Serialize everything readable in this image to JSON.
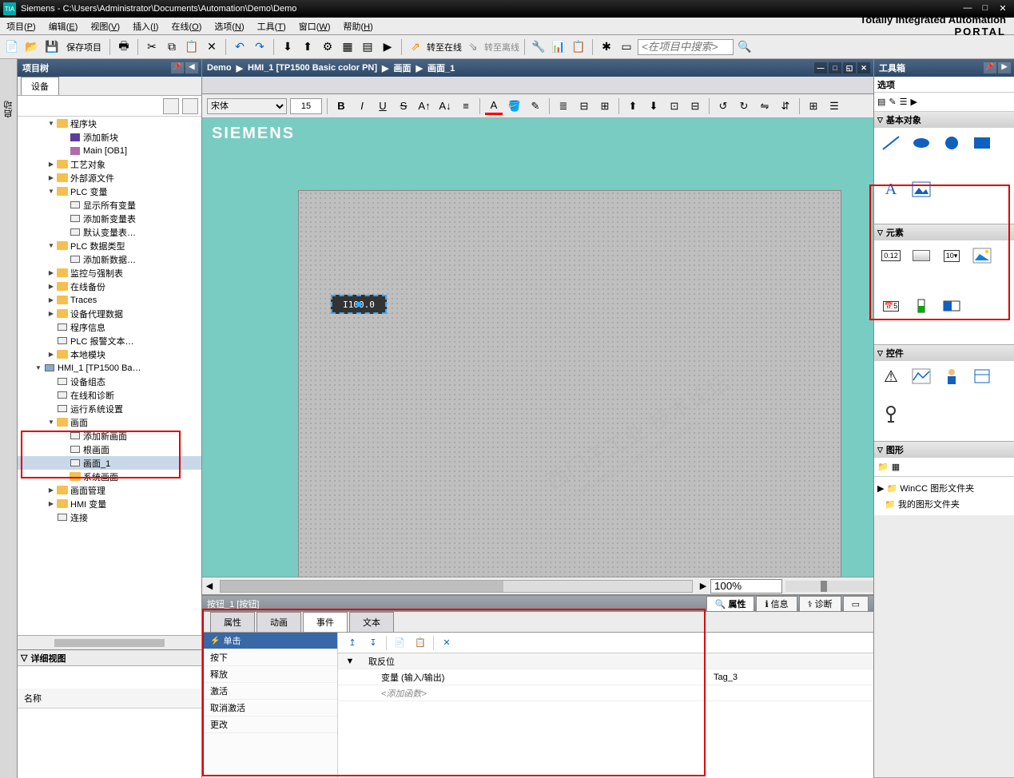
{
  "titlebar": {
    "app": "Siemens",
    "path": "C:\\Users\\Administrator\\Documents\\Automation\\Demo\\Demo"
  },
  "menu": {
    "items": [
      {
        "label": "项目",
        "key": "P"
      },
      {
        "label": "编辑",
        "key": "E"
      },
      {
        "label": "视图",
        "key": "V"
      },
      {
        "label": "插入",
        "key": "I"
      },
      {
        "label": "在线",
        "key": "O"
      },
      {
        "label": "选项",
        "key": "N"
      },
      {
        "label": "工具",
        "key": "T"
      },
      {
        "label": "窗口",
        "key": "W"
      },
      {
        "label": "帮助",
        "key": "H"
      }
    ]
  },
  "brand": {
    "line1": "Totally Integrated Automation",
    "line2": "PORTAL"
  },
  "toolbar": {
    "save_label": "保存项目",
    "go_online": "转至在线",
    "go_offline": "转至离线",
    "search_placeholder": "<在项目中搜索>"
  },
  "project_tree": {
    "title": "项目树",
    "tab": "设备",
    "detail_title": "详细视图",
    "detail_col": "名称",
    "nodes": [
      {
        "indent": 1,
        "exp": "▼",
        "label": "程序块",
        "type": "folder"
      },
      {
        "indent": 2,
        "exp": "",
        "label": "添加新块",
        "type": "block"
      },
      {
        "indent": 2,
        "exp": "",
        "label": "Main [OB1]",
        "type": "db"
      },
      {
        "indent": 1,
        "exp": "▶",
        "label": "工艺对象",
        "type": "folder"
      },
      {
        "indent": 1,
        "exp": "▶",
        "label": "外部源文件",
        "type": "folder"
      },
      {
        "indent": 1,
        "exp": "▼",
        "label": "PLC 变量",
        "type": "folder"
      },
      {
        "indent": 2,
        "exp": "",
        "label": "显示所有变量",
        "type": "screen"
      },
      {
        "indent": 2,
        "exp": "",
        "label": "添加新变量表",
        "type": "screen"
      },
      {
        "indent": 2,
        "exp": "",
        "label": "默认变量表…",
        "type": "screen"
      },
      {
        "indent": 1,
        "exp": "▼",
        "label": "PLC 数据类型",
        "type": "folder"
      },
      {
        "indent": 2,
        "exp": "",
        "label": "添加新数据…",
        "type": "screen"
      },
      {
        "indent": 1,
        "exp": "▶",
        "label": "监控与强制表",
        "type": "folder"
      },
      {
        "indent": 1,
        "exp": "▶",
        "label": "在线备份",
        "type": "folder"
      },
      {
        "indent": 1,
        "exp": "▶",
        "label": "Traces",
        "type": "folder"
      },
      {
        "indent": 1,
        "exp": "▶",
        "label": "设备代理数据",
        "type": "folder"
      },
      {
        "indent": 1,
        "exp": "",
        "label": "程序信息",
        "type": "screen"
      },
      {
        "indent": 1,
        "exp": "",
        "label": "PLC 报警文本…",
        "type": "screen"
      },
      {
        "indent": 1,
        "exp": "▶",
        "label": "本地模块",
        "type": "folder"
      },
      {
        "indent": 0,
        "exp": "▼",
        "label": "HMI_1 [TP1500 Ba…",
        "type": "hmi"
      },
      {
        "indent": 1,
        "exp": "",
        "label": "设备组态",
        "type": "screen"
      },
      {
        "indent": 1,
        "exp": "",
        "label": "在线和诊断",
        "type": "screen"
      },
      {
        "indent": 1,
        "exp": "",
        "label": "运行系统设置",
        "type": "screen"
      },
      {
        "indent": 1,
        "exp": "▼",
        "label": "画面",
        "type": "folder"
      },
      {
        "indent": 2,
        "exp": "",
        "label": "添加新画面",
        "type": "screen"
      },
      {
        "indent": 2,
        "exp": "",
        "label": "根画面",
        "type": "screen"
      },
      {
        "indent": 2,
        "exp": "",
        "label": "画面_1",
        "type": "screen",
        "selected": true
      },
      {
        "indent": 2,
        "exp": "",
        "label": "系统画面",
        "type": "folder"
      },
      {
        "indent": 1,
        "exp": "▶",
        "label": "画面管理",
        "type": "folder"
      },
      {
        "indent": 1,
        "exp": "▶",
        "label": "HMI 变量",
        "type": "folder"
      },
      {
        "indent": 1,
        "exp": "",
        "label": "连接",
        "type": "screen"
      }
    ]
  },
  "breadcrumb": {
    "parts": [
      "Demo",
      "HMI_1 [TP1500 Basic color PN]",
      "画面",
      "画面_1"
    ]
  },
  "format": {
    "font": "宋体",
    "size": "15"
  },
  "canvas": {
    "logo": "SIEMENS",
    "button_text": "I100.0",
    "zoom": "100%",
    "watermark1": "西门子工业 技术论坛",
    "watermark2": "support.industry.siemens.com/cs"
  },
  "inspector": {
    "title": "按钮_1 [按钮]",
    "top_tabs": {
      "props": "属性",
      "info": "信息",
      "diag": "诊断"
    },
    "tabs": {
      "props": "属性",
      "anim": "动画",
      "events": "事件",
      "text": "文本"
    },
    "events": [
      "单击",
      "按下",
      "释放",
      "激活",
      "取消激活",
      "更改"
    ],
    "func_header": "取反位",
    "func_param_label": "变量 (输入/输出)",
    "func_param_value": "Tag_3",
    "add_func": "<添加函数>"
  },
  "toolbox": {
    "title": "工具箱",
    "options": "选项",
    "sections": {
      "basic": "基本对象",
      "elements": "元素",
      "controls": "控件",
      "graphics": "图形"
    },
    "graphics_items": [
      "WinCC 图形文件夹",
      "我的图形文件夹"
    ]
  },
  "left_vtab": "启动"
}
